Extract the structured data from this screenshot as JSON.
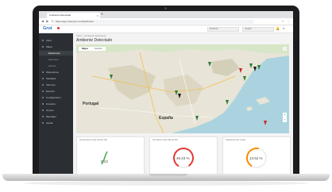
{
  "browser": {
    "tab_title": "Ambiente Detectado",
    "url": "https://app.example.com/dashboard",
    "nav_glyphs": "◀ ▶ ↻",
    "ext_glyphs": "☆ ⋮"
  },
  "header": {
    "logo_text": "Grut",
    "selects": [
      "Ambiente",
      "Usuario"
    ]
  },
  "sidebar": {
    "items": [
      {
        "label": "Inicio",
        "sub": false,
        "active": false
      },
      {
        "label": "Mapa",
        "sub": false,
        "active": false
      },
      {
        "label": "Estaciones",
        "sub": true,
        "active": true
      },
      {
        "label": "Sensores",
        "sub": true,
        "active": false
      },
      {
        "label": "Alertas",
        "sub": true,
        "active": false
      },
      {
        "label": "Dispositivos",
        "sub": false,
        "active": false
      },
      {
        "label": "Variables",
        "sub": false,
        "active": false
      },
      {
        "label": "Informes",
        "sub": false,
        "active": false
      },
      {
        "label": "Eventos",
        "sub": false,
        "active": false
      },
      {
        "label": "Configuración",
        "sub": false,
        "active": false
      },
      {
        "label": "Usuarios",
        "sub": false,
        "active": false
      },
      {
        "label": "Grupos",
        "sub": false,
        "active": false
      },
      {
        "label": "Mensajes",
        "sub": false,
        "active": false
      },
      {
        "label": "Ayuda",
        "sub": false,
        "active": false
      }
    ]
  },
  "main": {
    "breadcrumb": "Inicio > Ambiente Detectado",
    "title": "Ambiente Detectado",
    "map": {
      "tabs": [
        "Mapa",
        "Satélite"
      ],
      "labels": {
        "portugal": "Portugal",
        "espana": "España"
      },
      "fullscreen_icon": "⛶",
      "zoom_in": "+",
      "zoom_out": "−"
    },
    "cards": [
      {
        "title": "Temperatura media últimas 24h",
        "value": "0.13",
        "level": 0.13,
        "color": "#4caf50",
        "type": "line"
      },
      {
        "title": "Humedad media últimas 24h",
        "value": "46.23 %",
        "level": 0.82,
        "color": "#e53935",
        "type": "gauge"
      },
      {
        "title": "Calidad del aire media",
        "value": "13.52 %",
        "level": 0.45,
        "color": "#fb8c00",
        "type": "gauge"
      }
    ]
  },
  "colors": {
    "sidebar_bg": "#2b2f33",
    "accent": "#2c6fb7",
    "marker_green": "#2e7d32",
    "marker_red": "#c62828"
  }
}
